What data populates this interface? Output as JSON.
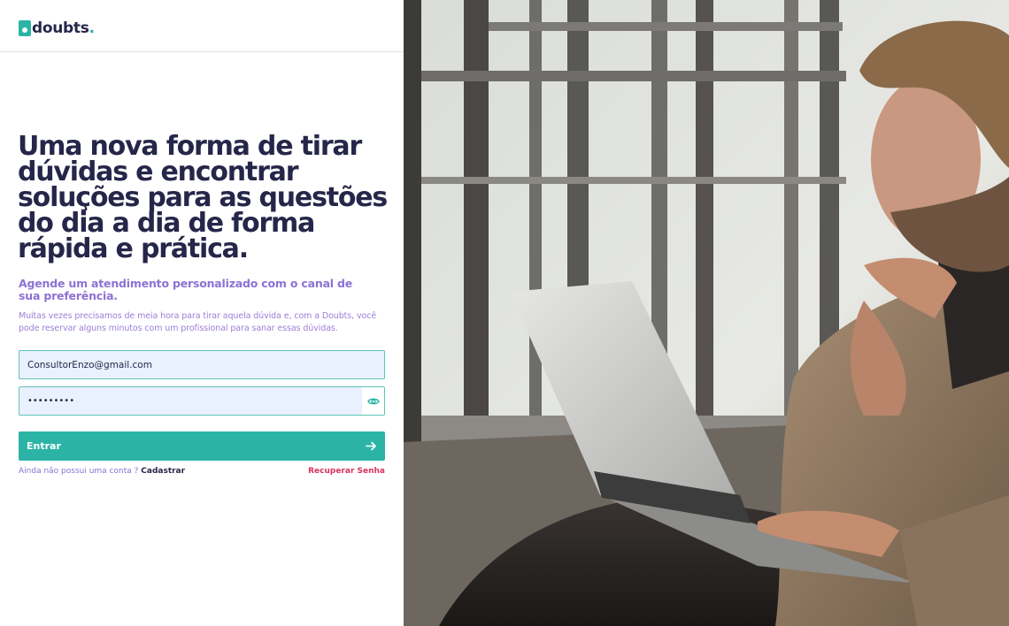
{
  "brand": {
    "name": "doubts",
    "dot": "."
  },
  "hero": {
    "headline": "Uma nova forma de tirar dúvidas e encontrar soluções para as questões do dia a dia de forma rápida e prática.",
    "subheadline": "Agende um atendimento personalizado com o canal de sua preferência.",
    "description": "Muitas vezes precisamos de meia hora para tirar aquela dúvida e, com a Doubts, você pode reservar alguns minutos com um profissional para sanar essas dúvidas."
  },
  "form": {
    "email_value": "ConsultorEnzo@gmail.com",
    "password_value": "•••••••••",
    "submit_label": "Entrar",
    "signup_prompt": "Ainda não possui uma conta ?",
    "signup_link": "Cadastrar",
    "recover_link": "Recuperar Senha"
  },
  "icons": {
    "toggle_password": "eye-icon",
    "submit": "arrow-right-icon"
  },
  "colors": {
    "primary": "#2bb4a6",
    "heading": "#26264a",
    "accent_purple": "#8b72d4",
    "link_red": "#d8325f",
    "input_bg": "#e9f1ff"
  }
}
